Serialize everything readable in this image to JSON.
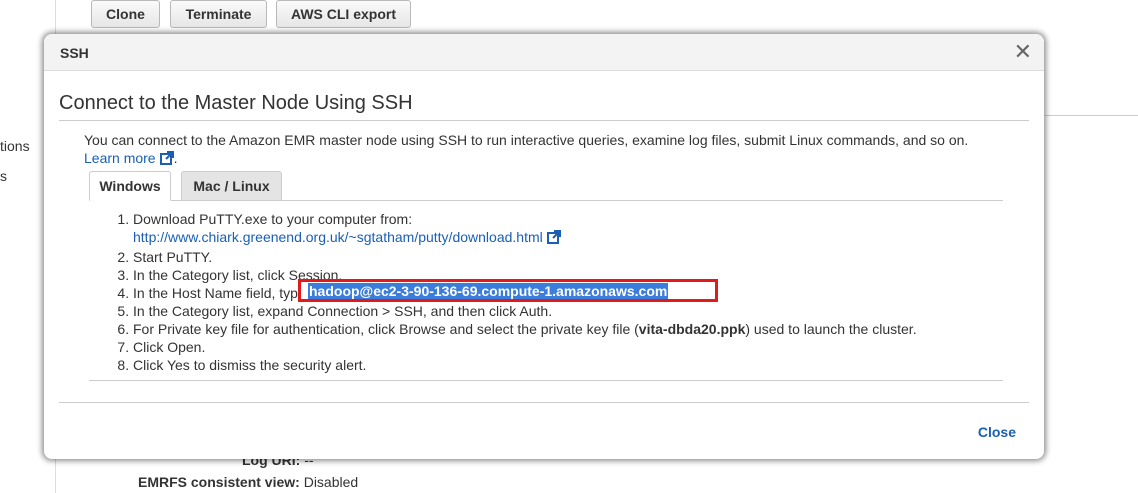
{
  "background": {
    "buttons": [
      "Clone",
      "Terminate",
      "AWS CLI export"
    ],
    "left_fragments": [
      "tions",
      "s"
    ],
    "rows": [
      {
        "label": "Log URI:",
        "value": "--"
      },
      {
        "label": "EMRFS consistent view:",
        "value": "Disabled"
      }
    ]
  },
  "modal": {
    "header_title": "SSH",
    "close_icon": "close-icon",
    "section_title": "Connect to the Master Node Using SSH",
    "intro_text": "You can connect to the Amazon EMR master node using SSH to run interactive queries, examine log files, submit Linux commands, and so on.",
    "learn_more": "Learn more",
    "tabs": [
      {
        "label": "Windows",
        "active": true
      },
      {
        "label": "Mac / Linux",
        "active": false
      }
    ],
    "steps": {
      "s1_text": "Download PuTTY.exe to your computer from:",
      "s1_link": "http://www.chiark.greenend.org.uk/~sgtatham/putty/download.html",
      "s2": "Start PuTTY.",
      "s3": "In the Category list, click Session.",
      "s4_prefix": "In the Host Name field, type ",
      "s4_host": "hadoop@ec2-3-90-136-69.compute-1.amazonaws.com",
      "s5": "In the Category list, expand Connection > SSH, and then click Auth.",
      "s6_prefix": "For Private key file for authentication, click Browse and select the private key file (",
      "s6_key": "vita-dbda20.ppk",
      "s6_suffix": ") used to launch the cluster.",
      "s7": "Click Open.",
      "s8": "Click Yes to dismiss the security alert."
    },
    "close_button": "Close"
  },
  "colors": {
    "link": "#1a5fb4",
    "highlight": "#3b7ddd",
    "annotation_red": "#e21a1a"
  }
}
